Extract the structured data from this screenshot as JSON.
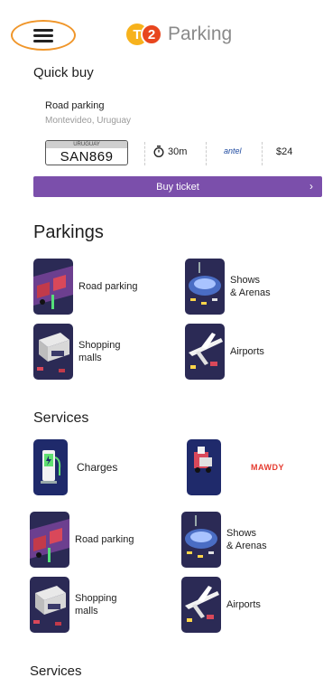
{
  "header": {
    "logo_mark": "T2",
    "logo_text": "Parking"
  },
  "quick_buy": {
    "title": "Quick buy",
    "parking_name": "Road parking",
    "location": "Montevideo, Uruguay",
    "plate_country": "URUGUAY",
    "plate": "SAN869",
    "duration": "30m",
    "operator": "antel",
    "price": "$24",
    "buy_label": "Buy ticket"
  },
  "parkings": {
    "title": "Parkings",
    "items": [
      {
        "label": "Road parking"
      },
      {
        "label": "Shows\n& Arenas"
      },
      {
        "label": "Shopping\nmalls"
      },
      {
        "label": "Airports"
      }
    ]
  },
  "services": {
    "title": "Services",
    "items": [
      {
        "label": "Charges"
      },
      {
        "label": "MAWDY"
      }
    ]
  },
  "parkings_repeat": {
    "items": [
      {
        "label": "Road parking"
      },
      {
        "label": "Shows\n& Arenas"
      },
      {
        "label": "Shopping\nmalls"
      },
      {
        "label": "Airports"
      }
    ]
  },
  "services_repeat": {
    "title": "Services"
  },
  "colors": {
    "accent": "#7b4fab",
    "menu_highlight": "#f0962a",
    "tile_bg": "#2b2a55"
  }
}
